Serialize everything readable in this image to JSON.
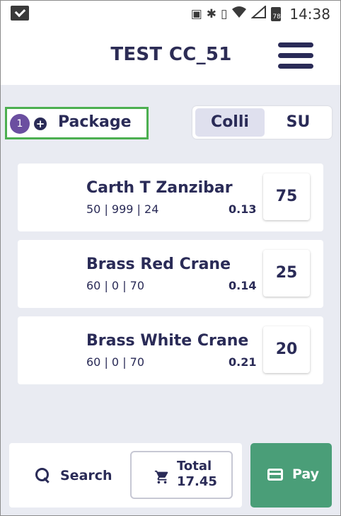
{
  "status_bar": {
    "time": "14:38",
    "battery": "78",
    "icons": [
      "check-notification-icon",
      "cast-icon",
      "bluetooth-icon",
      "vibrate-icon",
      "wifi-icon",
      "signal-icon",
      "battery-icon"
    ]
  },
  "header": {
    "title": "TEST CC_51",
    "menu_icon": "hamburger-menu-icon"
  },
  "package": {
    "count": "1",
    "label": "Package",
    "icon": "plus-circle-icon",
    "highlight_color": "#4caf50"
  },
  "toggle": {
    "options": [
      "Colli",
      "SU"
    ],
    "selected": "Colli"
  },
  "items": [
    {
      "name": "Carth T Zanzibar",
      "meta": "50  | 999  | 24",
      "price": "0.13",
      "qty": "75"
    },
    {
      "name": "Brass Red Crane",
      "meta": "60  | 0  | 70",
      "price": "0.14",
      "qty": "25"
    },
    {
      "name": "Brass White Crane",
      "meta": "60  | 0  | 70",
      "price": "0.21",
      "qty": "20"
    }
  ],
  "footer": {
    "search_label": "Search",
    "total_label": "Total",
    "total_value": "17.45",
    "pay_label": "Pay"
  },
  "colors": {
    "primary": "#2a2b57",
    "pay": "#4a9e78",
    "badge": "#6b4fa0",
    "background": "#e9ebf2"
  }
}
